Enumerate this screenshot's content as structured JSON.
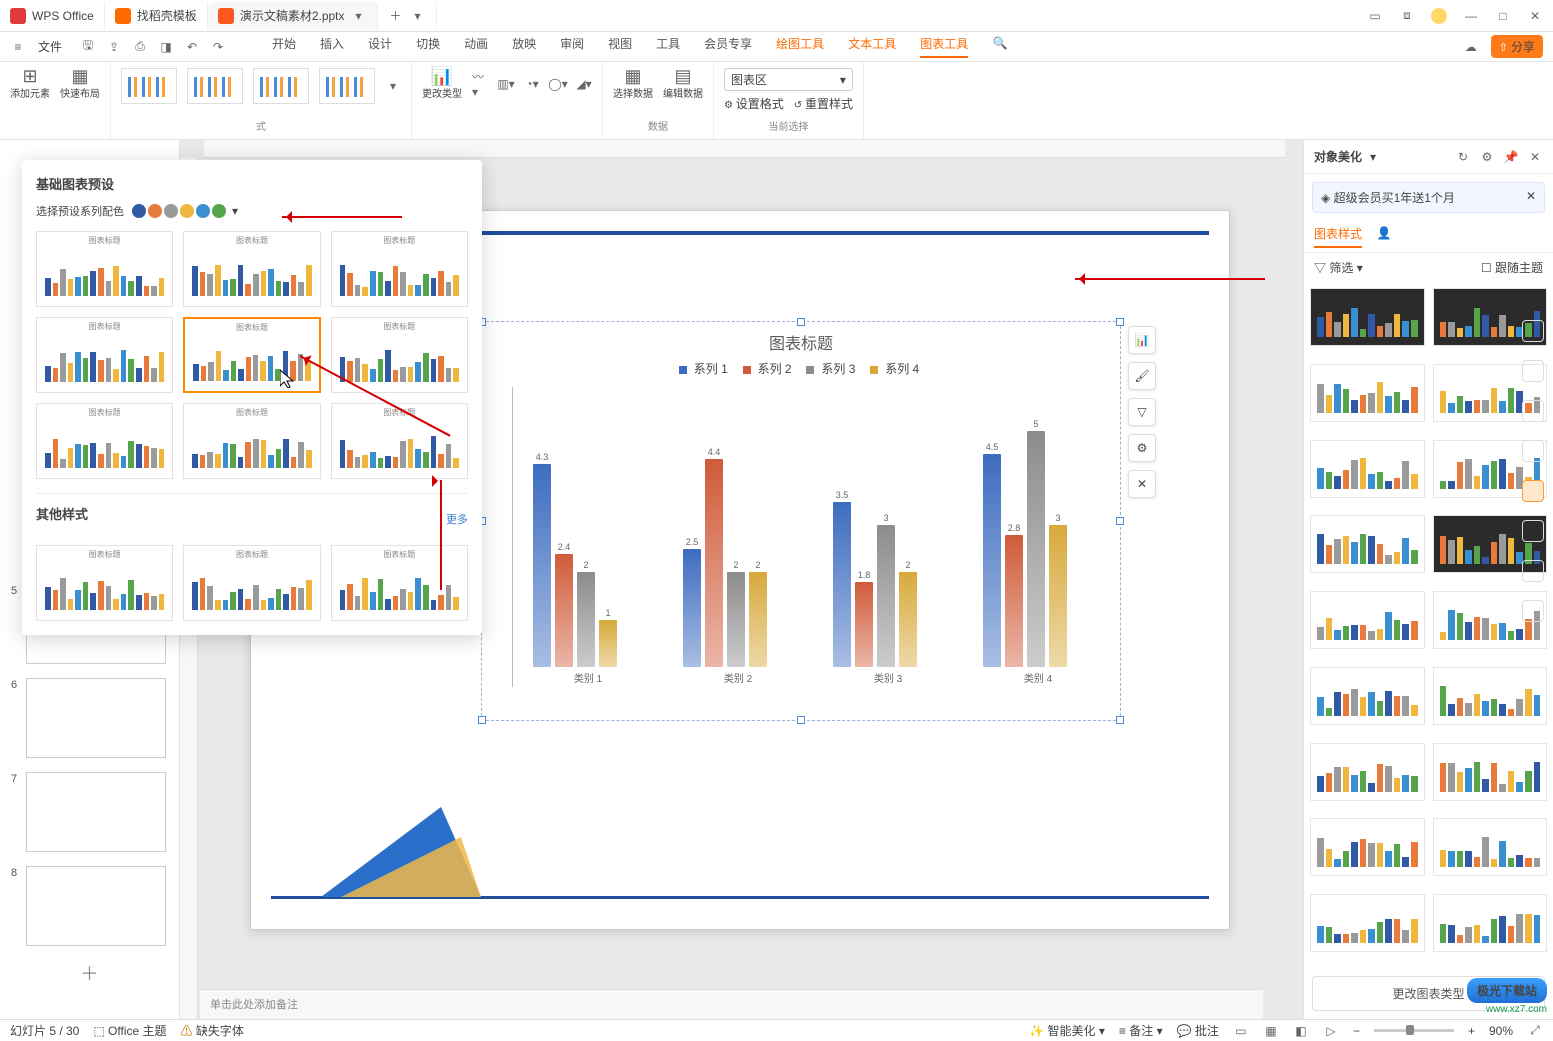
{
  "titlebar": {
    "app": "WPS Office",
    "tab_template": "找稻壳模板",
    "doc_name": "演示文稿素材2.pptx"
  },
  "menubar": {
    "file": "文件",
    "tabs": [
      "开始",
      "插入",
      "设计",
      "切换",
      "动画",
      "放映",
      "审阅",
      "视图",
      "工具",
      "会员专享"
    ],
    "orange_tabs": [
      "绘图工具",
      "文本工具",
      "图表工具"
    ],
    "share": "分享"
  },
  "ribbon": {
    "g1_add": "添加元素",
    "g1_layout": "快速布局",
    "g2_change": "更改类型",
    "g2_label": "式",
    "g3_select": "选择数据",
    "g3_edit": "编辑数据",
    "g3_label": "数据",
    "g4_dropdown": "图表区",
    "g4_fmt": "设置格式",
    "g4_reset": "重置样式",
    "g4_label": "当前选择"
  },
  "popover": {
    "title": "基础图表预设",
    "color_label": "选择预设系列配色",
    "other_title": "其他样式",
    "more": "更多",
    "preset_title": "图表标题"
  },
  "chart_data": {
    "type": "bar",
    "title": "图表标题",
    "legend": [
      "系列 1",
      "系列 2",
      "系列 3",
      "系列 4"
    ],
    "colors": [
      "#3d6cc0",
      "#d05b3a",
      "#8c8c8c",
      "#d7a93b"
    ],
    "categories": [
      "类别 1",
      "类别 2",
      "类别 3",
      "类别 4"
    ],
    "series": [
      {
        "name": "系列 1",
        "values": [
          4.3,
          2.5,
          3.5,
          4.5
        ]
      },
      {
        "name": "系列 2",
        "values": [
          2.4,
          4.4,
          1.8,
          2.8
        ]
      },
      {
        "name": "系列 3",
        "values": [
          2,
          2,
          3,
          5
        ]
      },
      {
        "name": "系列 4",
        "values": [
          1,
          2,
          2,
          3
        ]
      }
    ],
    "ylim": [
      0,
      5.5
    ]
  },
  "rpanel": {
    "title": "对象美化",
    "vip": "超级会员买1年送1个月",
    "tab_style": "图表样式",
    "filter": "筛选",
    "follow_theme": "跟随主题",
    "change_type": "更改图表类型"
  },
  "notes": "单击此处添加备注",
  "status": {
    "slide": "幻灯片 5 / 30",
    "theme": "Office 主题",
    "missing": "缺失字体",
    "beautify": "智能美化",
    "notes_btn": "备注",
    "comments": "批注",
    "zoom": "90%"
  },
  "slides": [
    5,
    6,
    7,
    8
  ],
  "watermark": {
    "name": "极光下载站",
    "url": "www.xz7.com"
  },
  "palette": [
    "#315aa6",
    "#e87a3a",
    "#9a9a9a",
    "#efb73e",
    "#3a8fd1",
    "#57a54a"
  ]
}
